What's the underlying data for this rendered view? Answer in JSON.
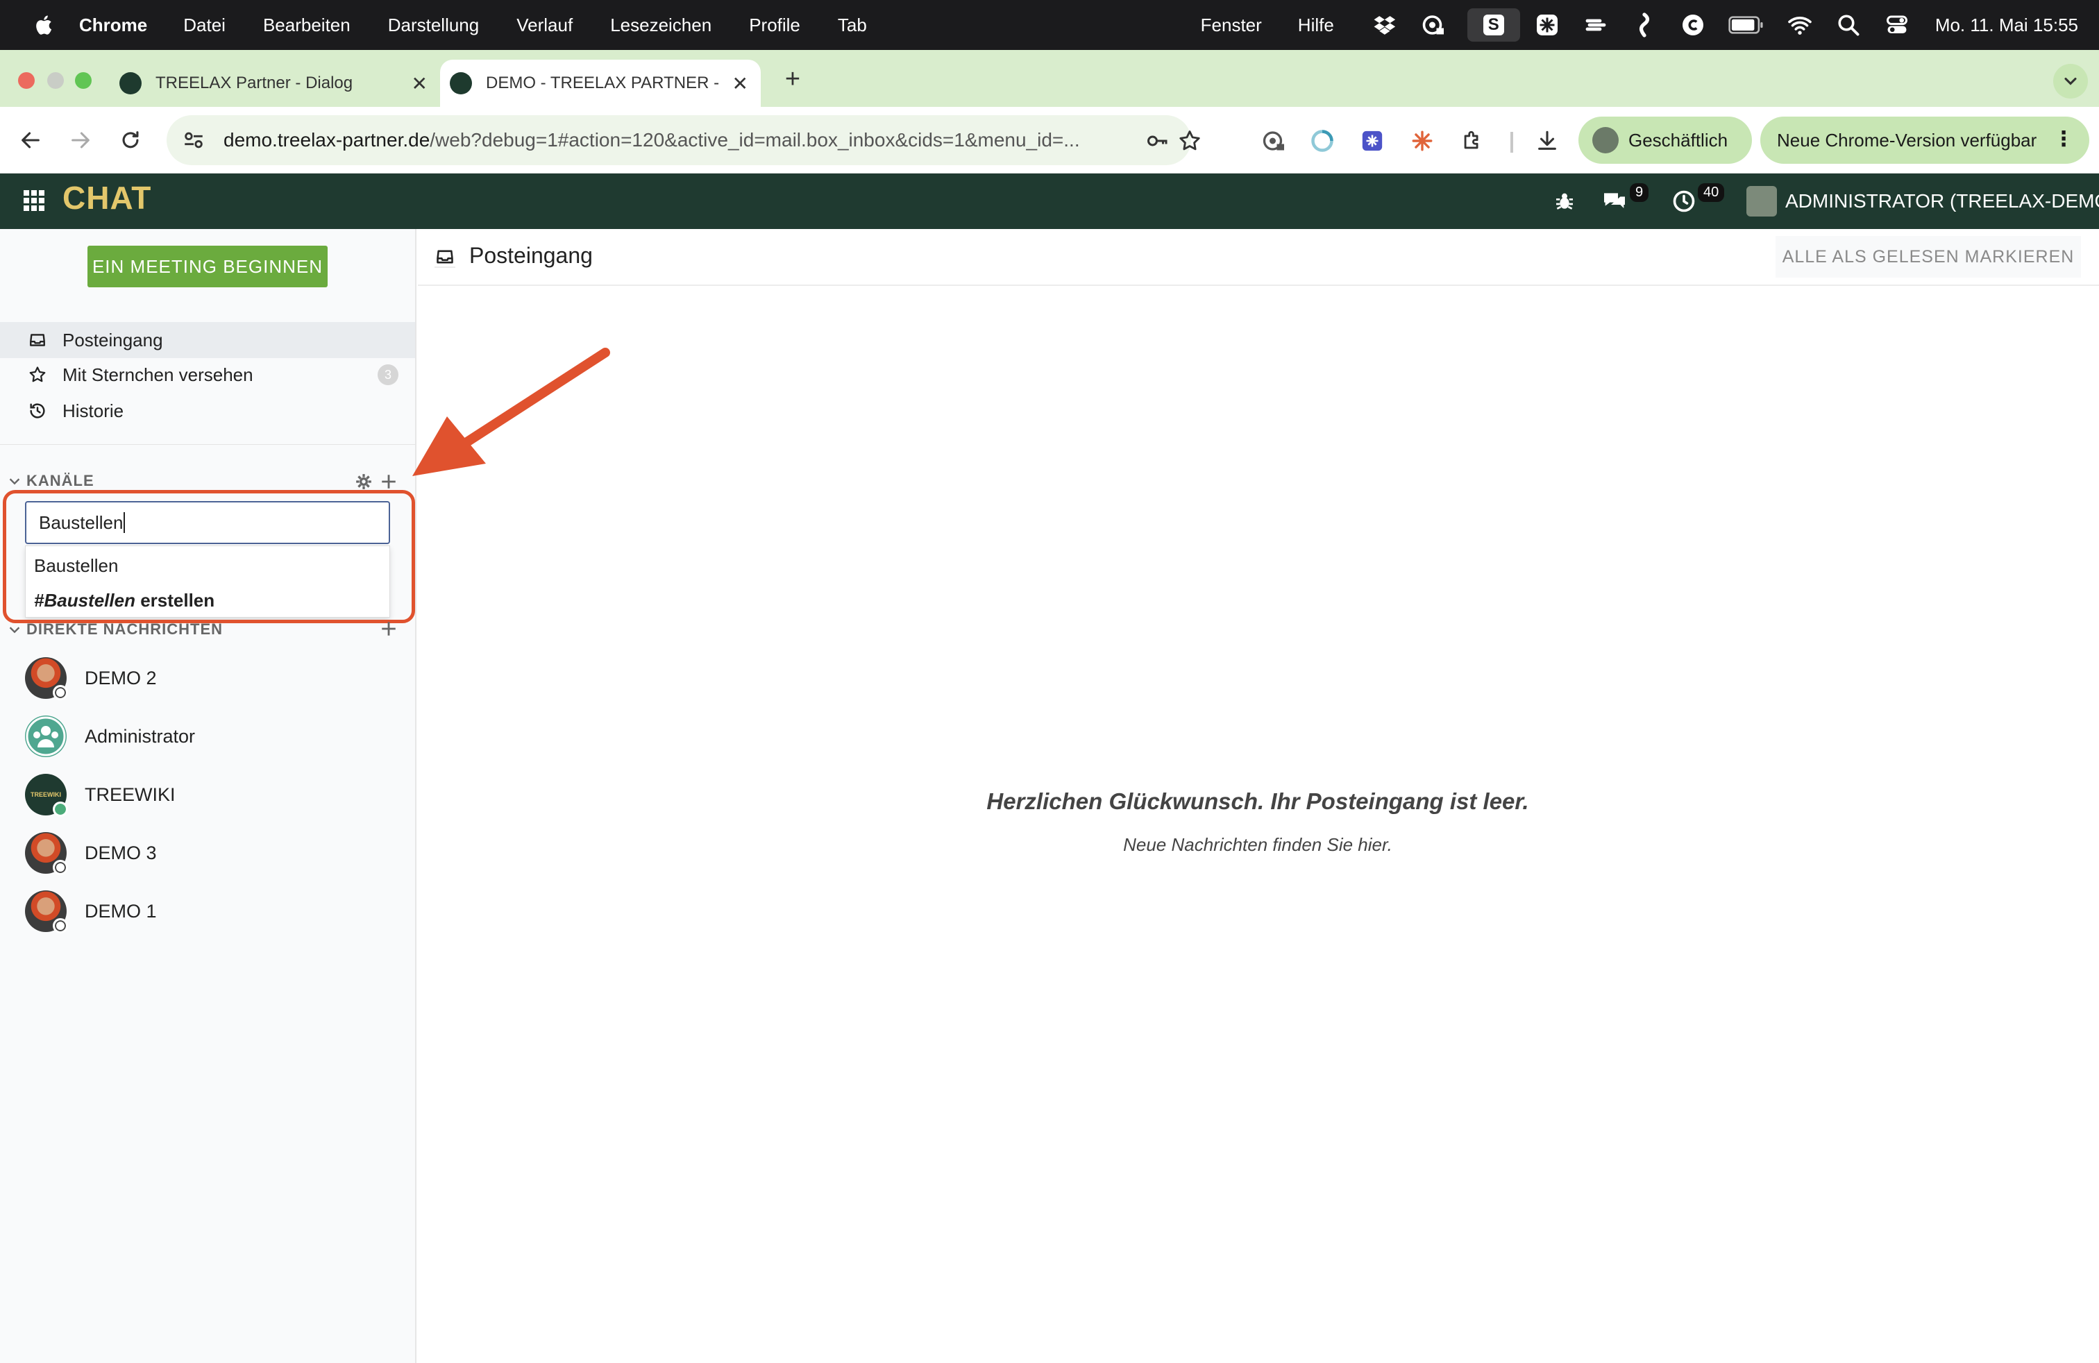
{
  "macos_menubar": {
    "app": "Chrome",
    "menus": [
      "Datei",
      "Bearbeiten",
      "Darstellung",
      "Verlauf",
      "Lesezeichen",
      "Profile",
      "Tab"
    ],
    "right_menus": [
      "Fenster",
      "Hilfe"
    ],
    "status_icons": [
      "dropbox-icon",
      "vpn-icon",
      "s-app-icon",
      "snowflake-icon",
      "layers-icon",
      "stack-icon",
      "c-app-icon",
      "battery-icon",
      "wifi-icon",
      "spotlight-icon",
      "control-center-icon"
    ],
    "s_app_label": "S",
    "datetime": "Mo. 11. Mai  15:55"
  },
  "browser": {
    "tabs": [
      {
        "title": "TREELAX Partner - Dialog",
        "active": false
      },
      {
        "title": "DEMO - TREELAX PARTNER -",
        "active": true
      }
    ],
    "url_host": "demo.treelax-partner.de",
    "url_rest": "/web?debug=1#action=120&active_id=mail.box_inbox&cids=1&menu_id=...",
    "profile_label": "Geschäftlich",
    "update_label": "Neue Chrome-Version verfügbar"
  },
  "navbar": {
    "brand": "CHAT",
    "messages_count": "9",
    "activities_count": "40",
    "user": "ADMINISTRATOR (TREELAX-DEMO)"
  },
  "sidebar": {
    "meeting_button": "EIN MEETING BEGINNEN",
    "mailboxes": [
      {
        "label": "Posteingang",
        "active": true
      },
      {
        "label": "Mit Sternchen versehen",
        "counter": "3"
      },
      {
        "label": "Historie"
      }
    ],
    "channels": {
      "header": "KANÄLE",
      "input_value": "Baustellen",
      "suggestions": [
        {
          "text": "Baustellen"
        },
        {
          "prefix": "#",
          "name": "Baustellen",
          "suffix": " erstellen"
        }
      ]
    },
    "direct_messages": {
      "header": "DIREKTE NACHRICHTEN",
      "items": [
        {
          "name": "DEMO 2",
          "status": "offline"
        },
        {
          "name": "Administrator",
          "status": "none"
        },
        {
          "name": "TREEWIKI",
          "status": "online",
          "avatar_text": "TREEWIKI"
        },
        {
          "name": "DEMO 3",
          "status": "offline"
        },
        {
          "name": "DEMO 1",
          "status": "offline"
        }
      ]
    }
  },
  "main": {
    "title": "Posteingang",
    "mark_all_read": "ALLE ALS GELESEN MARKIEREN",
    "empty_title": "Herzlichen Glückwunsch. Ihr Posteingang ist leer.",
    "empty_subtitle": "Neue Nachrichten finden Sie hier."
  },
  "colors": {
    "navbar_bg": "#1f3a30",
    "brand": "#e3c76b",
    "meeting_button": "#6bab3e",
    "annotation_red": "#e0522e",
    "chrome_tabstrip": "#d9edcd"
  }
}
